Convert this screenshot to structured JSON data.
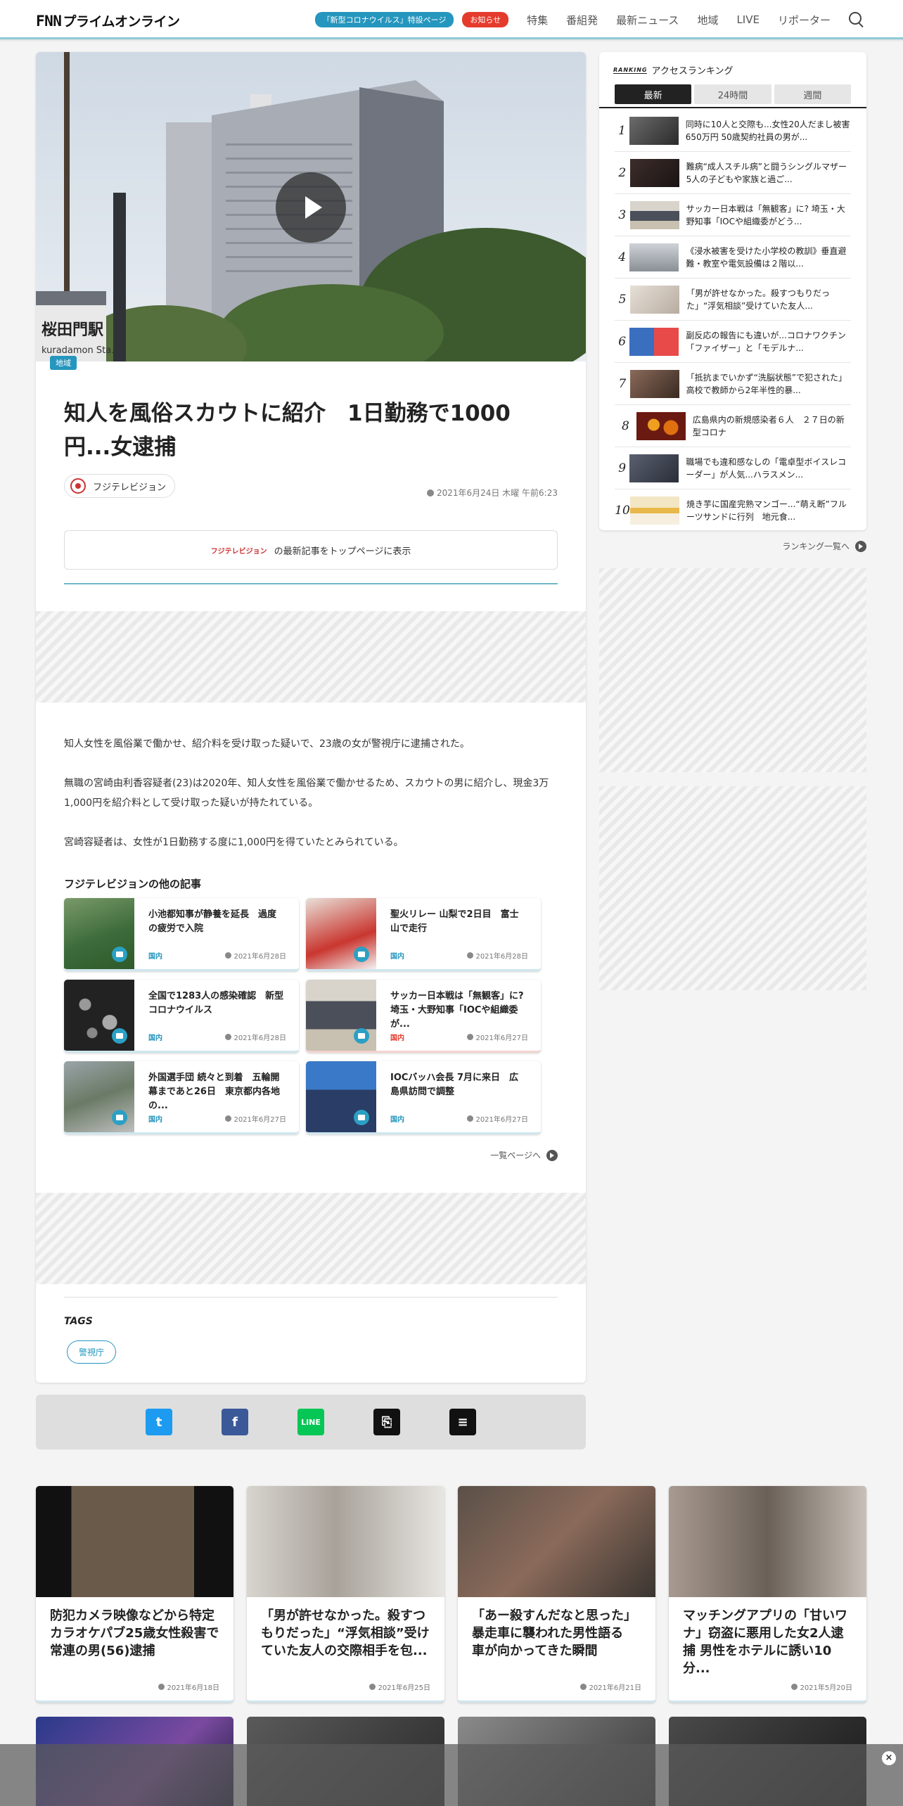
{
  "header": {
    "logo": "プライムオンライン",
    "logo_mark": "FNN",
    "special_pill": "「新型コロナウイルス」特設ページ",
    "notice_pill": "お知らせ",
    "nav": [
      "特集",
      "番組発",
      "最新ニュース",
      "地域",
      "LIVE",
      "リポーター"
    ]
  },
  "article": {
    "category": "地域",
    "title": "知人を風俗スカウトに紹介　1日勤務で1000円...女逮捕",
    "source": "フジテレビジョン",
    "timestamp": "2021年6月24日 木曜 午前6:23",
    "banner_logo": "フジテレビジョン",
    "banner_text": "の最新記事をトップページに表示",
    "paragraphs": [
      "知人女性を風俗業で働かせ、紹介料を受け取った疑いで、23歳の女が警視庁に逮捕された。",
      "無職の宮崎由利香容疑者(23)は2020年、知人女性を風俗業で働かせるため、スカウトの男に紹介し、現金3万1,000円を紹介料として受け取った疑いが持たれている。",
      "宮崎容疑者は、女性が1日勤務する度に1,000円を得ていたとみられている。"
    ],
    "others_title": "フジテレビジョンの他の記事",
    "others": [
      {
        "title": "小池都知事が静養を延長　過度の疲労で入院",
        "category": "国内",
        "date": "2021年6月28日"
      },
      {
        "title": "聖火リレー 山梨で2日目　富士山で走行",
        "category": "国内",
        "date": "2021年6月28日"
      },
      {
        "title": "全国で1283人の感染確認　新型コロナウイルス",
        "category": "国内",
        "date": "2021年6月28日"
      },
      {
        "title": "サッカー日本戦は「無観客」に? 埼玉・大野知事「IOCや組織委が...",
        "category": "国内",
        "date": "2021年6月27日"
      },
      {
        "title": "外国選手団 続々と到着　五輪開幕まであと26日　東京都内各地の...",
        "category": "国内",
        "date": "2021年6月27日"
      },
      {
        "title": "IOCバッハ会長 7月に来日　広島県訪問で調整",
        "category": "国内",
        "date": "2021年6月27日"
      }
    ],
    "more_link": "一覧ページへ",
    "tags_label": "TAGS",
    "tags": [
      "警視庁"
    ]
  },
  "share": {
    "twitter": "t",
    "facebook": "f",
    "line": "LINE",
    "link": "⎘",
    "comment": "≡"
  },
  "ranking": {
    "badge": "RANKING",
    "title": "アクセスランキング",
    "tabs": [
      "最新",
      "24時間",
      "週間"
    ],
    "items": [
      {
        "rank": "1",
        "title": "同時に10人と交際も...女性20人だまし被害650万円 50歳契約社員の男が..."
      },
      {
        "rank": "2",
        "title": "難病“成人スチル病”と闘うシングルマザー　5人の子どもや家族と過ご..."
      },
      {
        "rank": "3",
        "title": "サッカー日本戦は「無観客」に? 埼玉・大野知事「IOCや組織委がどう..."
      },
      {
        "rank": "4",
        "title": "《浸水被害を受けた小学校の教訓》垂直避難・教室や電気設備は２階以..."
      },
      {
        "rank": "5",
        "title": "「男が許せなかった。殺すつもりだった」“浮気相談”受けていた友人..."
      },
      {
        "rank": "6",
        "title": "副反応の報告にも違いが...コロナワクチン「ファイザー」と「モデルナ..."
      },
      {
        "rank": "7",
        "title": "「抵抗までいかず“洗脳状態”で犯された」高校で教師から2年半性的暴..."
      },
      {
        "rank": "8",
        "title": "広島県内の新規感染者６人　２７日の新型コロナ"
      },
      {
        "rank": "9",
        "title": "職場でも違和感なしの「電卓型ボイスレコーダー」が人気...ハラスメン..."
      },
      {
        "rank": "10",
        "title": "焼き芋に国産完熟マンゴー...“萌え断”フルーツサンドに行列　地元食..."
      }
    ],
    "more_link": "ランキング一覧へ"
  },
  "features": [
    {
      "title": "防犯カメラ映像などから特定　カラオケパブ25歳女性殺害で常連の男(56)逮捕",
      "date": "2021年6月18日"
    },
    {
      "title": "「男が許せなかった。殺すつもりだった」“浮気相談”受けていた友人の交際相手を包...",
      "date": "2021年6月25日"
    },
    {
      "title": "「あー殺すんだなと思った」暴走車に襲われた男性語る　車が向かってきた瞬間",
      "date": "2021年6月21日"
    },
    {
      "title": "マッチングアプリの「甘いワナ」窃盗に悪用した女2人逮捕 男性をホテルに誘い10分...",
      "date": "2021年5月20日"
    }
  ],
  "overlay": {
    "close": "×"
  },
  "colors": {
    "accent": "#2596be",
    "alert": "#e53b2c",
    "header_rule": "#8fc9d6"
  }
}
